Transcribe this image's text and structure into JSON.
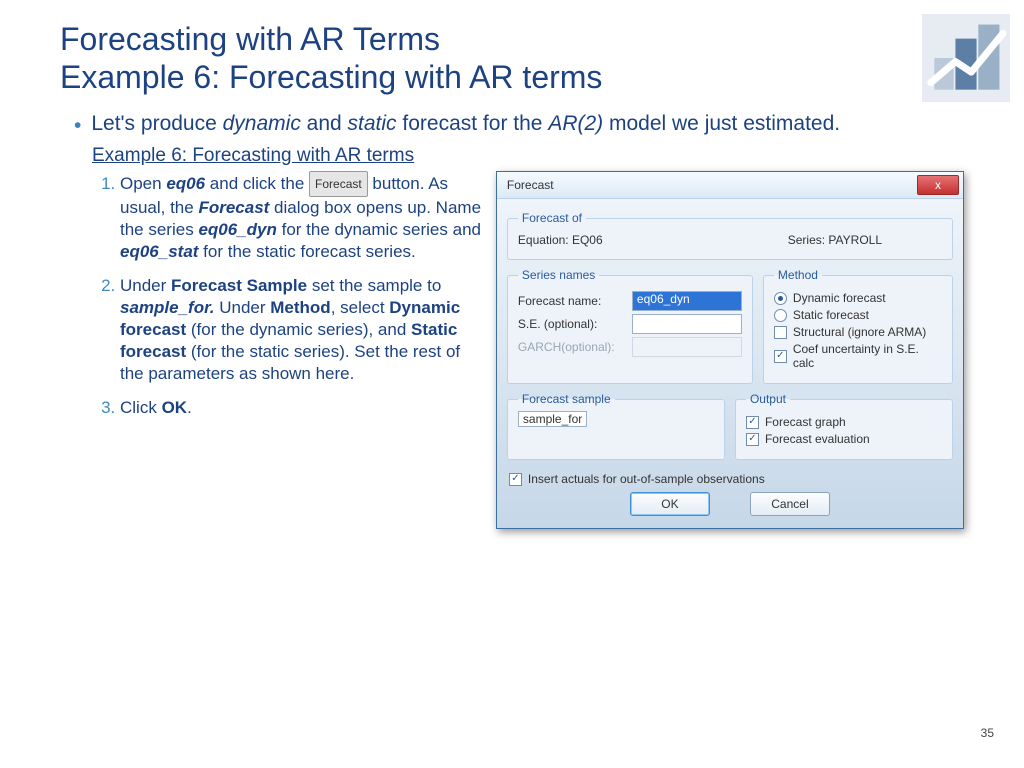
{
  "title_line1": "Forecasting with AR Terms",
  "title_line2": "Example 6: Forecasting with AR terms",
  "bullet": {
    "pre": "Let's produce ",
    "dyn": "dynamic",
    "mid1": " and ",
    "stat": "static",
    "mid2": " forecast for the ",
    "ar2": "AR(2)",
    "post": " model we just estimated."
  },
  "example_heading": "Example 6: Forecasting with AR terms",
  "steps": {
    "s1": {
      "open": "Open ",
      "eq06": "eq06",
      "and_click": " and click the ",
      "forecast_btn": "Forecast",
      "button_as_usual": " button. As usual, the ",
      "forecast_b": "Forecast",
      "dialog_opens": " dialog box opens up. Name the series ",
      "eq06_dyn": "eq06_dyn",
      "for_dyn": " for the dynamic series and ",
      "eq06_stat": "eq06_stat",
      "for_stat": " for the static forecast series."
    },
    "s2": {
      "under": "Under ",
      "fs": "Forecast Sample",
      "set_to": " set the sample to ",
      "sample_for": "sample_for.",
      "under2": " Under ",
      "method": "Method",
      "select": ", select ",
      "dynf": "Dynamic forecast",
      "for_dyn": " (for the dynamic series), and ",
      "statf": "Static forecast",
      "for_stat": " (for the static series). Set the rest of the parameters as shown here."
    },
    "s3": {
      "click": "Click ",
      "ok": "OK",
      "dot": "."
    }
  },
  "dialog": {
    "title": "Forecast",
    "close": "x",
    "forecast_of": {
      "legend": "Forecast of",
      "equation": "Equation: EQ06",
      "series": "Series: PAYROLL"
    },
    "series_names": {
      "legend": "Series names",
      "forecast_name_label": "Forecast name:",
      "forecast_name_value": "eq06_dyn",
      "se_label": "S.E. (optional):",
      "se_value": "",
      "garch_label": "GARCH(optional):"
    },
    "method": {
      "legend": "Method",
      "dynamic": "Dynamic forecast",
      "static": "Static forecast",
      "structural": "Structural (ignore ARMA)",
      "coef": "Coef uncertainty in S.E. calc"
    },
    "forecast_sample": {
      "legend": "Forecast sample",
      "value": "sample_for"
    },
    "output": {
      "legend": "Output",
      "graph": "Forecast graph",
      "eval": "Forecast evaluation"
    },
    "actuals": "Insert actuals for out-of-sample observations",
    "ok": "OK",
    "cancel": "Cancel"
  },
  "page_number": "35"
}
